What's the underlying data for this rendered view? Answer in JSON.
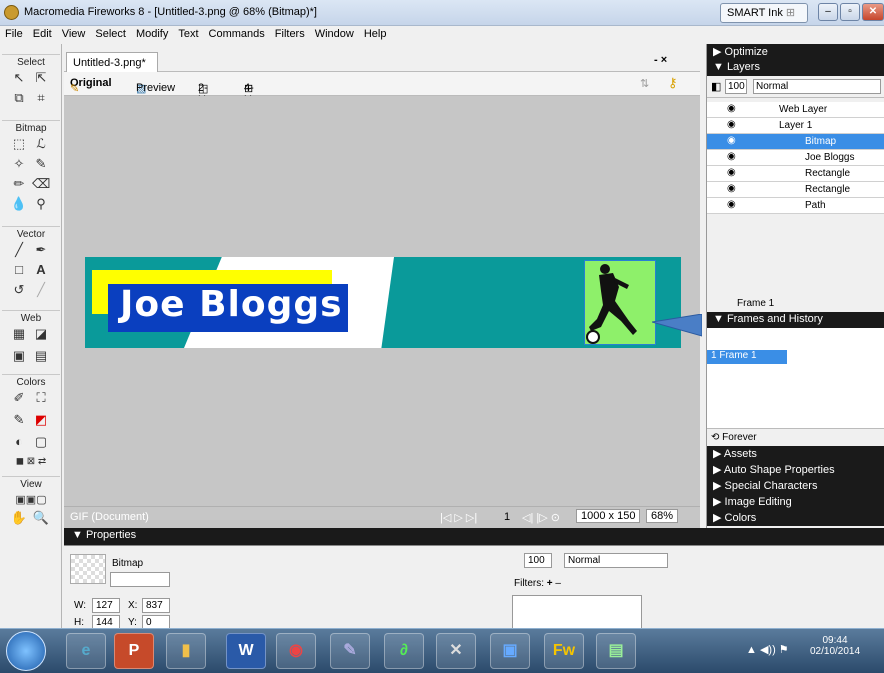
{
  "window": {
    "title": "Macromedia Fireworks 8 - [Untitled-3.png @ 68% (Bitmap)*]",
    "smart_ink": "SMART Ink"
  },
  "menu": [
    "File",
    "Edit",
    "View",
    "Select",
    "Modify",
    "Text",
    "Commands",
    "Filters",
    "Window",
    "Help"
  ],
  "tools": {
    "select": "Select",
    "bitmap": "Bitmap",
    "vector": "Vector",
    "web": "Web",
    "colors": "Colors",
    "view": "View"
  },
  "document": {
    "tab": "Untitled-3.png*",
    "close": "- ×",
    "views": [
      "Original",
      "Preview",
      "2-Up",
      "4-Up"
    ],
    "status_left": "GIF (Document)",
    "frame_num": "1",
    "size": "1000 x 150",
    "zoom": "68%"
  },
  "canvas": {
    "banner_text": "Joe Bloggs",
    "colors": {
      "teal": "#0a9a9a",
      "yellow": "#ffff00",
      "blue": "#0a3fbf",
      "green": "#8ef06a"
    }
  },
  "panels": {
    "optimize": "▶ Optimize",
    "layers": "▼ Layers",
    "opacity": "100",
    "blend": "Normal",
    "layer_rows": [
      {
        "name": "Web Layer",
        "selected": false
      },
      {
        "name": "Layer 1",
        "selected": false
      },
      {
        "name": "Bitmap",
        "selected": true
      },
      {
        "name": "Joe Bloggs",
        "selected": false
      },
      {
        "name": "Rectangle",
        "selected": false
      },
      {
        "name": "Rectangle",
        "selected": false
      },
      {
        "name": "Path",
        "selected": false
      }
    ],
    "frame_label": "Frame 1",
    "frames_history": "▼ Frames and History",
    "frame_row": "1  Frame 1",
    "loop": "Forever",
    "collapsed": [
      "▶ Assets",
      "▶ Auto Shape Properties",
      "▶ Special Characters",
      "▶ Image Editing",
      "▶ Colors"
    ]
  },
  "properties": {
    "header": "▼ Properties",
    "type": "Bitmap",
    "w_label": "W:",
    "w": "127",
    "x_label": "X:",
    "x": "837",
    "h_label": "H:",
    "h": "144",
    "y_label": "Y:",
    "y": "0",
    "opacity": "100",
    "blend": "Normal",
    "filters": "Filters:"
  },
  "taskbar": {
    "time": "09:44",
    "date": "02/10/2014"
  }
}
